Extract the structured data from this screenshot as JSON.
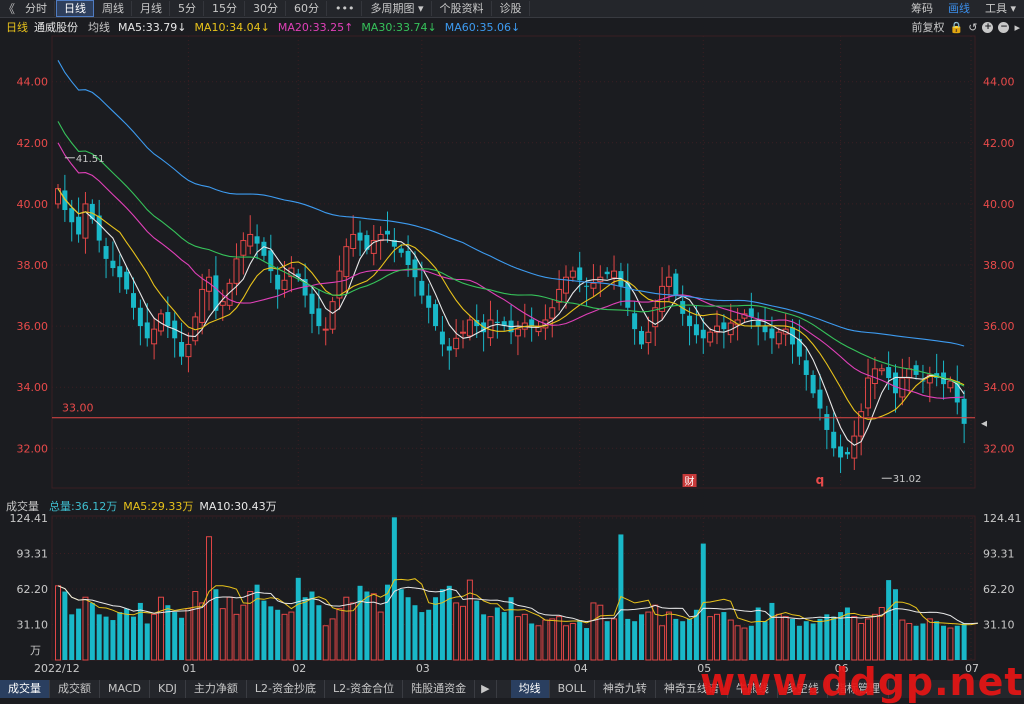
{
  "toolbar": {
    "nav_left": "《",
    "tabs": [
      "分时",
      "日线",
      "周线",
      "月线",
      "5分",
      "15分",
      "30分",
      "60分",
      "•••",
      "多周期图 ▾",
      "个股资料",
      "诊股"
    ],
    "active_tab": "日线",
    "right": [
      "筹码",
      "画线",
      "工具 ▾"
    ],
    "right_active": "画线"
  },
  "indicator_bar": {
    "period": "日线",
    "stock_name": "通威股份",
    "avg_label": "均线",
    "ma": [
      {
        "label": "MA5:33.79",
        "color": "#e8e8e8"
      },
      {
        "label": "MA10:34.04",
        "color": "#e8c21b"
      },
      {
        "label": "MA20:33.25",
        "color": "#e040b8"
      },
      {
        "label": "MA30:33.74",
        "color": "#36c25a"
      },
      {
        "label": "MA60:35.06",
        "color": "#3d9bf0"
      }
    ],
    "adjust": "前复权"
  },
  "volume_bar": {
    "title": "成交量",
    "total": "总量:36.12万",
    "ma5": "MA5:29.33万",
    "ma10": "MA10:30.43万"
  },
  "bottom_tabs": [
    "成交量",
    "成交额",
    "MACD",
    "KDJ",
    "主力净额",
    "L2-资金抄底",
    "L2-资金合位",
    "陆股通资金"
  ],
  "bottom_active": "成交量",
  "bottom_tabs2": [
    "均线",
    "BOLL",
    "神奇九转",
    "神奇五线谱",
    "牛熊线",
    "多空线",
    "指标管理"
  ],
  "bottom_active2": "均线",
  "watermark": "www.ddgp.net",
  "chart_data": {
    "type": "candlestick",
    "price_axis": {
      "min": 30.7,
      "max": 45.3,
      "ticks": [
        "32.00",
        "34.00",
        "36.00",
        "38.00",
        "40.00",
        "42.00",
        "44.00"
      ]
    },
    "volume_axis": {
      "min": 0,
      "max": 124.41,
      "ticks": [
        "124.41",
        "93.31",
        "62.20",
        "31.10"
      ],
      "unit": "万"
    },
    "x_labels": [
      {
        "label": "2022/12",
        "index": 0
      },
      {
        "label": "01",
        "index": 19
      },
      {
        "label": "02",
        "index": 35
      },
      {
        "label": "03",
        "index": 53
      },
      {
        "label": "04",
        "index": 76
      },
      {
        "label": "05",
        "index": 94
      },
      {
        "label": "06",
        "index": 114
      },
      {
        "label": "07",
        "index": 133
      }
    ],
    "horizontal_line": {
      "value": 33.0,
      "label": "33.00"
    },
    "annotations": [
      {
        "label": "41.51",
        "index": 1
      },
      {
        "label": "31.02",
        "index": 120
      }
    ],
    "markers": [
      {
        "label": "财",
        "index": 92
      },
      {
        "label": "q",
        "index": 111
      }
    ],
    "close": [
      40.5,
      39.8,
      39.4,
      39.0,
      40.0,
      39.5,
      38.8,
      38.2,
      37.9,
      37.6,
      37.2,
      36.6,
      36.0,
      35.6,
      35.9,
      36.4,
      36.0,
      35.6,
      35.0,
      35.4,
      36.3,
      37.2,
      37.6,
      36.5,
      36.8,
      37.4,
      38.2,
      38.8,
      39.0,
      38.7,
      38.3,
      37.8,
      37.2,
      37.5,
      37.9,
      37.6,
      37.0,
      36.4,
      36.0,
      35.9,
      36.8,
      37.8,
      38.6,
      39.0,
      38.8,
      38.5,
      38.8,
      39.0,
      39.0,
      38.6,
      38.4,
      38.0,
      37.6,
      37.0,
      36.6,
      36.0,
      35.4,
      35.2,
      35.6,
      35.8,
      36.2,
      36.0,
      35.8,
      36.2,
      36.1,
      36.0,
      35.8,
      35.9,
      36.1,
      36.0,
      36.0,
      36.2,
      36.6,
      37.2,
      37.6,
      37.8,
      37.5,
      37.3,
      37.4,
      37.6,
      37.7,
      37.8,
      37.3,
      36.6,
      35.9,
      35.4,
      35.8,
      36.6,
      37.3,
      37.6,
      37.0,
      36.4,
      36.0,
      35.7,
      35.6,
      35.8,
      36.0,
      35.9,
      36.1,
      36.2,
      36.4,
      36.3,
      36.0,
      35.8,
      35.6,
      35.8,
      35.9,
      35.4,
      35.0,
      34.4,
      33.8,
      33.3,
      32.6,
      32.0,
      31.7,
      31.8,
      32.4,
      33.2,
      34.3,
      34.6,
      34.6,
      34.3,
      33.8,
      34.3,
      34.6,
      34.4,
      34.2,
      34.4,
      34.3,
      34.1,
      34.2,
      33.5,
      32.8
    ],
    "volume": [
      65,
      60,
      40,
      45,
      55,
      50,
      40,
      38,
      35,
      42,
      45,
      38,
      50,
      32,
      40,
      55,
      48,
      42,
      37,
      45,
      60,
      50,
      108,
      62,
      45,
      55,
      40,
      48,
      60,
      66,
      52,
      47,
      44,
      40,
      42,
      72,
      55,
      60,
      48,
      30,
      36,
      45,
      55,
      50,
      65,
      60,
      58,
      42,
      66,
      125,
      62,
      55,
      48,
      42,
      44,
      55,
      62,
      65,
      50,
      47,
      70,
      52,
      40,
      38,
      46,
      42,
      55,
      38,
      40,
      32,
      30,
      35,
      36,
      38,
      30,
      32,
      35,
      28,
      50,
      48,
      34,
      36,
      110,
      36,
      34,
      40,
      42,
      48,
      30,
      42,
      36,
      34,
      36,
      44,
      102,
      38,
      40,
      42,
      35,
      30,
      28,
      30,
      46,
      34,
      50,
      40,
      38,
      36,
      30,
      34,
      32,
      36,
      40,
      38,
      42,
      46,
      38,
      32,
      36,
      40,
      46,
      70,
      62,
      35,
      32,
      30,
      32,
      36,
      34,
      30,
      28,
      30,
      32,
      35,
      36
    ]
  }
}
